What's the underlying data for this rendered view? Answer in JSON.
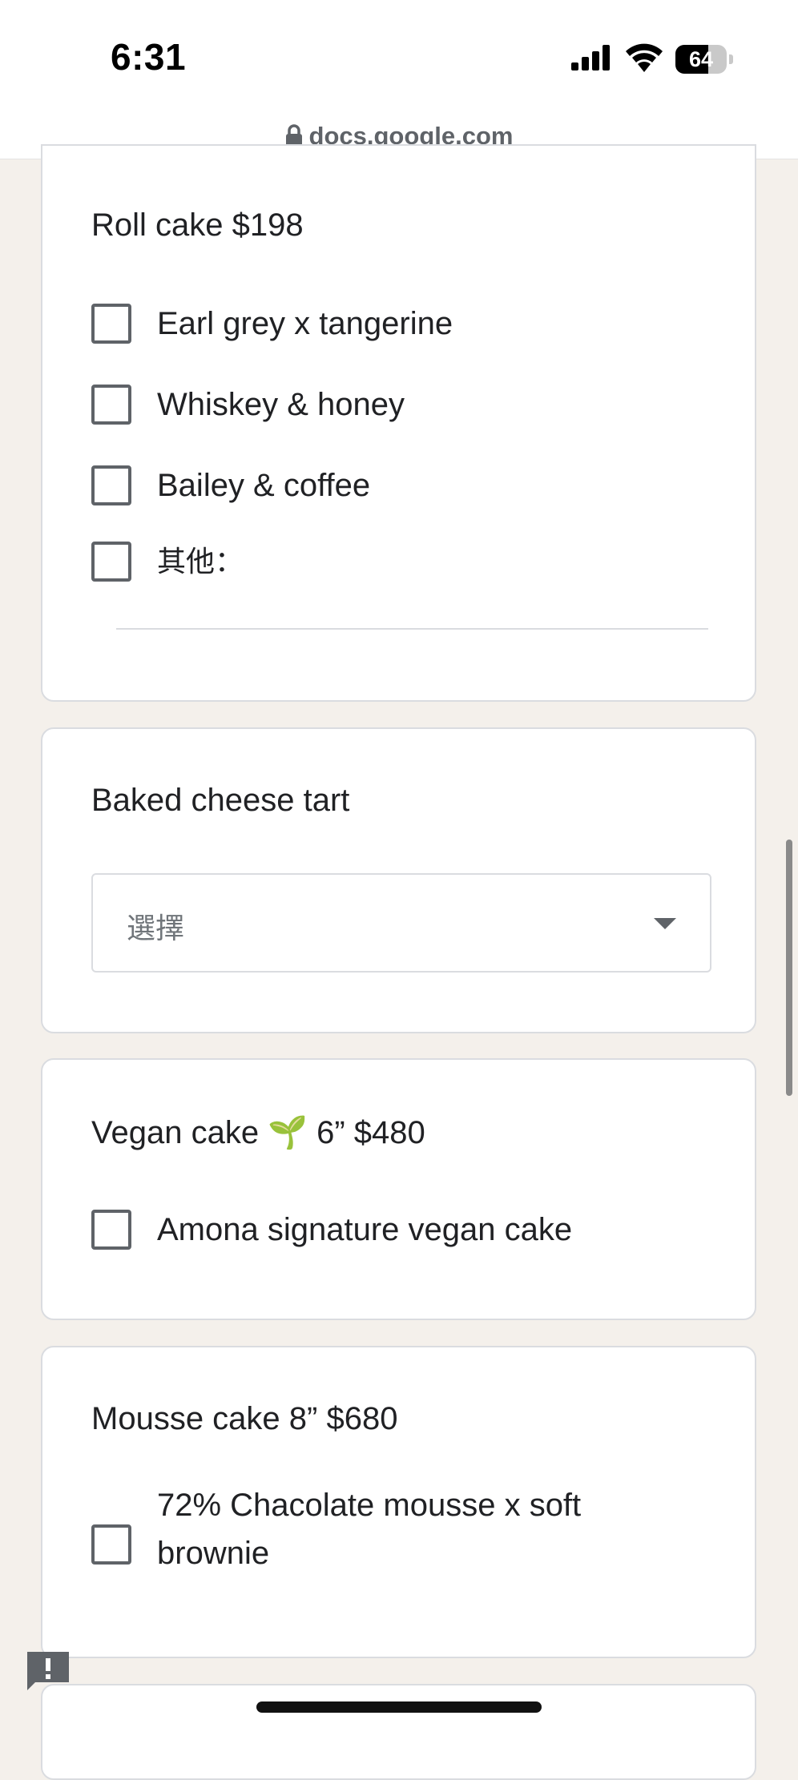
{
  "status_bar": {
    "time": "6:31",
    "battery_percent": "64",
    "battery_level": 0.64
  },
  "browser": {
    "url": "docs.google.com"
  },
  "form": {
    "roll_cake": {
      "title": "Roll cake $198",
      "options": [
        "Earl grey x tangerine",
        "Whiskey & honey",
        "Bailey & coffee"
      ],
      "other_label": "其他："
    },
    "cheese_tart": {
      "title": "Baked cheese tart",
      "select_placeholder": "選擇"
    },
    "vegan_cake": {
      "title": "Vegan cake 🌱 6” $480",
      "options": [
        "Amona signature vegan cake"
      ]
    },
    "mousse_cake": {
      "title": "Mousse cake 8” $680",
      "options": [
        "72% Chacolate mousse x soft brownie"
      ]
    }
  },
  "colors": {
    "page_background": "#f4f0eb",
    "card_background": "#ffffff",
    "card_border": "#dadce0",
    "checkbox_border": "#5f6368",
    "text_primary": "#202124"
  }
}
